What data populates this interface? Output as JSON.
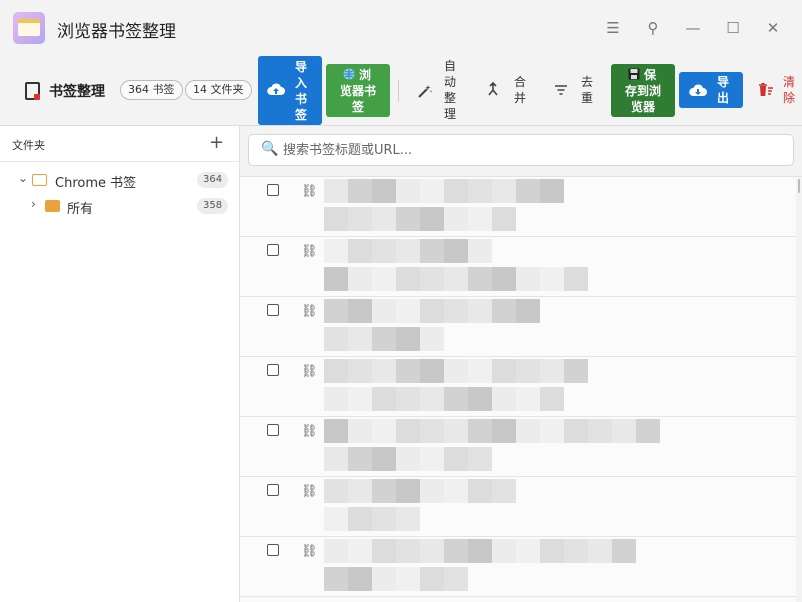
{
  "app": {
    "title": "浏览器书签整理"
  },
  "window_controls": {
    "menu": "☰",
    "pin": "⚲",
    "minimize": "—",
    "maximize": "☐",
    "close": "✕"
  },
  "toolbar": {
    "title": "书签整理",
    "bookmark_count": "364 书签",
    "folder_count": "14 文件夹",
    "import_label": [
      "导",
      "入",
      "书",
      "签"
    ],
    "browse_label": [
      "浏",
      "览器书",
      "签"
    ],
    "auto_label": [
      "自",
      "动",
      "整",
      "理"
    ],
    "merge_label": [
      "合",
      "并"
    ],
    "dedupe_label": [
      "去",
      "重"
    ],
    "save_label": [
      "保",
      "存到浏",
      "览器"
    ],
    "export_label": [
      "导",
      "出"
    ],
    "clear_label": [
      "清",
      "除"
    ]
  },
  "sidebar": {
    "header": "文件夹",
    "add": "+",
    "tree": [
      {
        "name": "Chrome 书签",
        "count": "364"
      },
      {
        "name": "所有",
        "count": "358"
      }
    ]
  },
  "search": {
    "placeholder": "搜索书签标题或URL..."
  },
  "icons": {
    "app": "app-icon",
    "doc": "document-icon",
    "cloud_upload": "cloud-upload-icon",
    "globe": "globe-icon",
    "magic": "magic-wand-icon",
    "merge": "merge-icon",
    "filter": "filter-icon",
    "save": "save-icon",
    "cloud_download": "cloud-download-icon",
    "trash": "trash-icon",
    "search": "search-icon",
    "link": "link-icon"
  },
  "colors": {
    "import": "#1976d2",
    "browse": "#43a047",
    "save": "#2e7d32",
    "export": "#1976d2",
    "clear": "#d32f2f",
    "folder": "#e8a33c"
  },
  "bookmarks": [
    {
      "state": "obscured"
    },
    {
      "state": "obscured"
    },
    {
      "state": "obscured"
    },
    {
      "state": "obscured"
    },
    {
      "state": "obscured"
    },
    {
      "state": "obscured"
    },
    {
      "state": "obscured"
    }
  ]
}
